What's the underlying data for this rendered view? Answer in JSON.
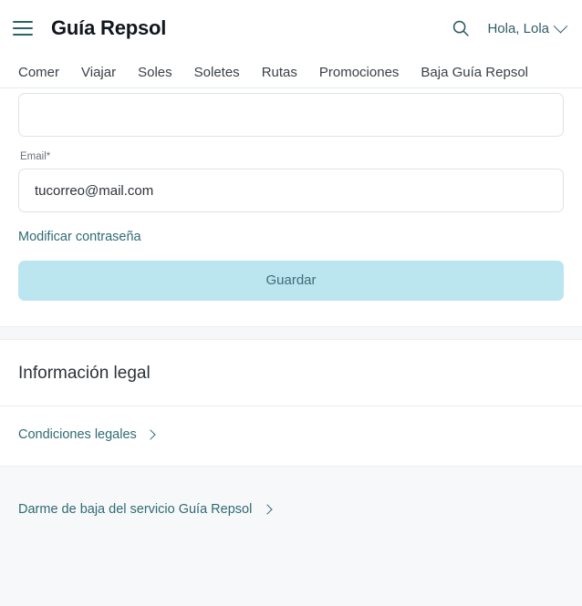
{
  "header": {
    "menu_icon": "hamburger-menu-icon",
    "brand": "Guía Repsol",
    "search_icon": "search-icon",
    "user_greeting": "Hola, Lola",
    "user_chevron_icon": "chevron-down-icon"
  },
  "nav": {
    "items": [
      {
        "label": "Comer"
      },
      {
        "label": "Viajar"
      },
      {
        "label": "Soles"
      },
      {
        "label": "Soletes"
      },
      {
        "label": "Rutas"
      },
      {
        "label": "Promociones"
      },
      {
        "label": "Baja Guía Repsol"
      }
    ]
  },
  "form": {
    "first_field_value": "",
    "first_field_placeholder": "",
    "email_label": "Email*",
    "email_value": "tucorreo@mail.com",
    "email_placeholder": "tucorreo@mail.com",
    "change_password_link": "Modificar contraseña",
    "save_label": "Guardar"
  },
  "legal": {
    "title": "Información legal",
    "conditions_link": "Condiciones legales",
    "conditions_chevron_icon": "chevron-right-icon"
  },
  "unsubscribe": {
    "link": "Darme de baja del servicio Guía Repsol",
    "chevron_icon": "chevron-right-icon"
  },
  "colors": {
    "accent_teal": "#2f6b74",
    "button_bg": "#bbe5ef",
    "button_text": "#3d6e78",
    "page_bg": "#ffffff",
    "band_bg": "#f7f8f9",
    "border": "#dfe2e5",
    "nav_text": "#3a3f46",
    "brand_text": "#11161f"
  }
}
